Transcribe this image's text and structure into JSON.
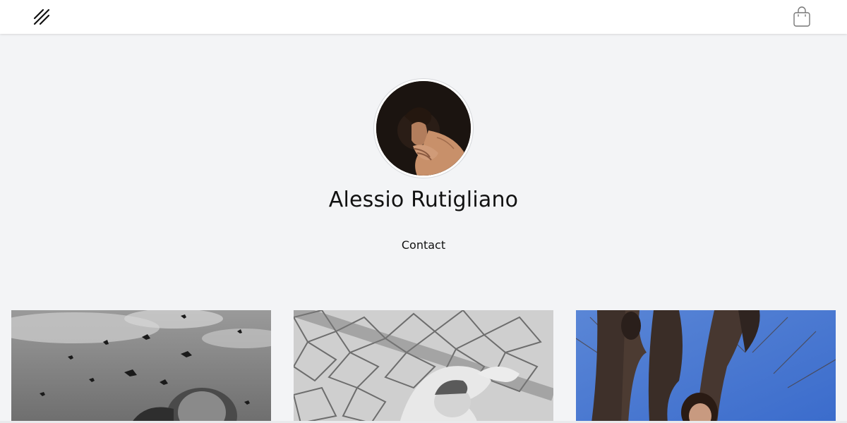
{
  "header": {
    "logo_icon": "double-slash-logo-icon",
    "cart_icon": "shopping-bag-icon"
  },
  "profile": {
    "name": "Alessio Rutigliano",
    "contact_label": "Contact"
  },
  "gallery": {
    "items": [
      {
        "tone": "black-and-white",
        "subject": "man-under-birds"
      },
      {
        "tone": "black-and-white",
        "subject": "woman-on-mosaic"
      },
      {
        "tone": "color",
        "subject": "woman-between-trees"
      }
    ]
  },
  "colors": {
    "background": "#f3f4f6",
    "header_bg": "#ffffff",
    "text": "#111111"
  }
}
